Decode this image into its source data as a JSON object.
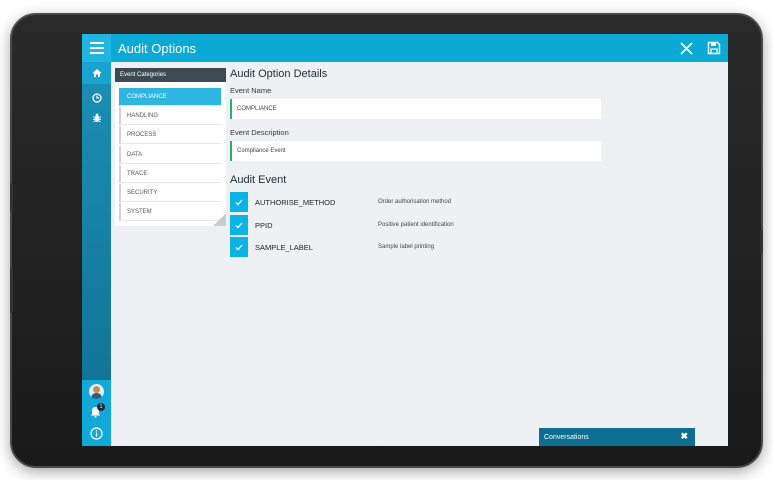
{
  "header": {
    "title": "Audit Options"
  },
  "nav": {
    "items": [
      "home-icon",
      "clock-icon",
      "bug-icon"
    ],
    "bottom": [
      "avatar",
      "bell-icon",
      "info-icon"
    ],
    "notification_count": "1"
  },
  "categories": {
    "header": "Event Categories",
    "items": [
      "COMPLIANCE",
      "HANDLING",
      "PROCESS",
      "DATA",
      "TRACE",
      "SECURITY",
      "SYSTEM"
    ],
    "selected": "COMPLIANCE"
  },
  "details": {
    "title": "Audit Option Details",
    "event_name_label": "Event Name",
    "event_name_value": "COMPLIANCE",
    "event_desc_label": "Event Description",
    "event_desc_value": "Compliance Event"
  },
  "audit_event": {
    "title": "Audit Event",
    "rows": [
      {
        "name": "AUTHORISE_METHOD",
        "desc": "Order authorisation method",
        "checked": true
      },
      {
        "name": "PPID",
        "desc": "Positive patient identification",
        "checked": true
      },
      {
        "name": "SAMPLE_LABEL",
        "desc": "Sample label printing",
        "checked": true
      }
    ]
  },
  "conversations": {
    "label": "Conversations"
  },
  "colors": {
    "topbar": "#0aa9d6",
    "accent": "#2eb5e0",
    "field_border": "#27b06b",
    "conversations": "#0e6e91"
  }
}
